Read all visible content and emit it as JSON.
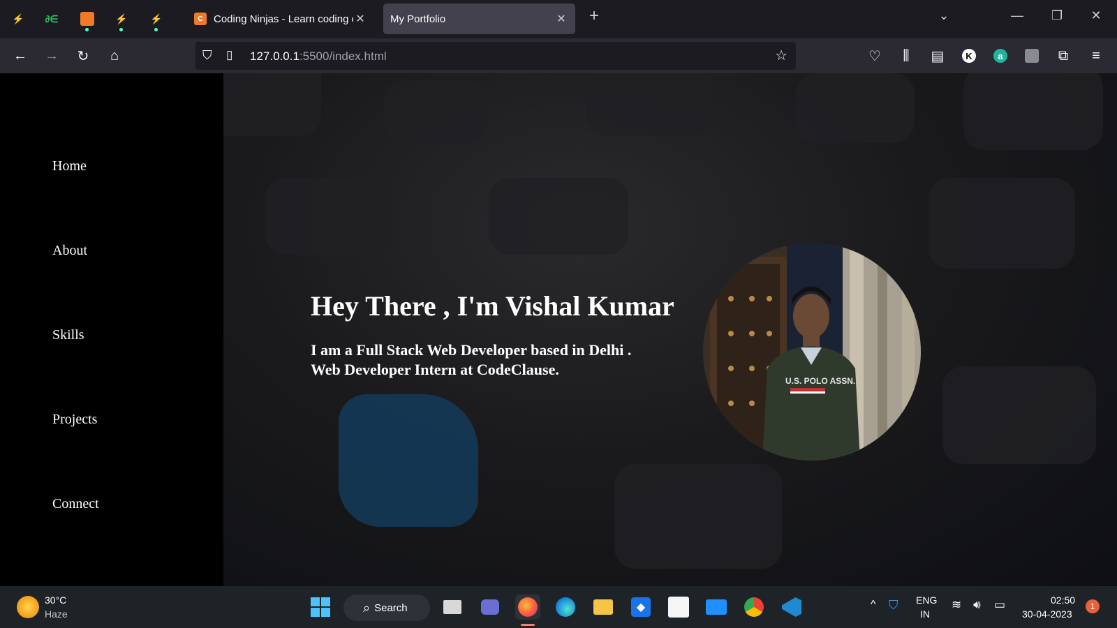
{
  "browser": {
    "tabs": [
      {
        "title": "Coding Ninjas - Learn coding online",
        "favicon": "coding-ninjas-icon",
        "active": false
      },
      {
        "title": "My Portfolio",
        "favicon": "none",
        "active": true
      }
    ],
    "url": {
      "host": "127.0.0.1",
      "rest": ":5500/index.html"
    }
  },
  "sidebar": {
    "items": [
      "Home",
      "About",
      "Skills",
      "Projects",
      "Connect"
    ]
  },
  "hero": {
    "heading": "Hey There , I'm Vishal Kumar",
    "line1": "I am a Full Stack Web Developer based in Delhi .",
    "line2": "Web Developer Intern at CodeClause.",
    "photo_shirt_text": "U.S. POLO ASSN."
  },
  "taskbar": {
    "weather_temp": "30°C",
    "weather_desc": "Haze",
    "search_label": "Search",
    "lang_top": "ENG",
    "lang_bottom": "IN",
    "time": "02:50",
    "date": "30-04-2023",
    "notification_count": "1"
  },
  "colors": {
    "accent": "#54ffbd",
    "tab_active": "#42414d",
    "sidebar": "#000000"
  }
}
